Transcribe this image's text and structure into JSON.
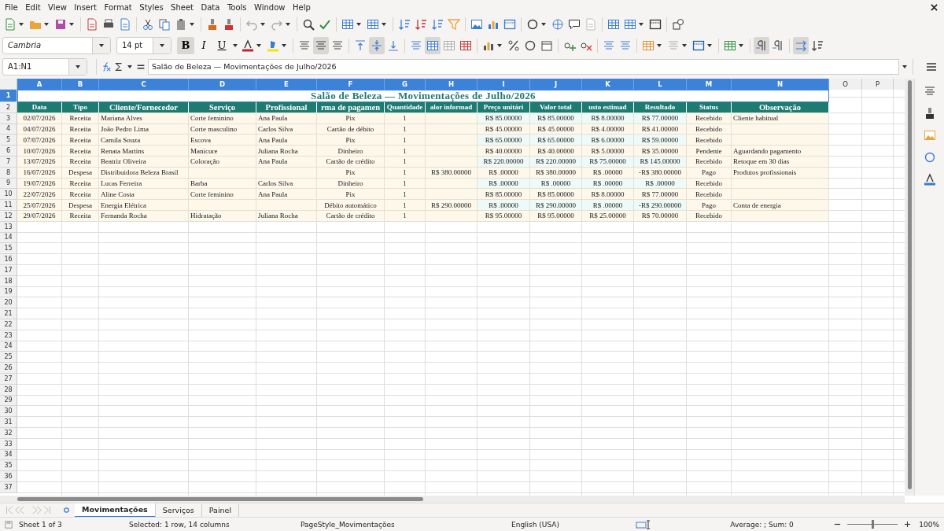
{
  "menu": [
    "File",
    "Edit",
    "View",
    "Insert",
    "Format",
    "Styles",
    "Sheet",
    "Data",
    "Tools",
    "Window",
    "Help"
  ],
  "font": {
    "name": "Cambria",
    "size": "14 pt"
  },
  "format_buttons": [
    {
      "label": "B",
      "pressed": true
    },
    {
      "label": "I",
      "pressed": false
    },
    {
      "label": "U",
      "pressed": false
    }
  ],
  "toggles": {
    "align_left": false,
    "align_center": true,
    "align_right": false,
    "align_top": false,
    "align_middle": true,
    "align_bottom": false,
    "wrap_text": false,
    "merge_center": true,
    "merge_cells": false,
    "unmerge_cells": false,
    "left_to_right": true,
    "right_to_left": false,
    "text_direction": true,
    "stacked_text": false
  },
  "formula_bar": {
    "name_box": "A1:N1",
    "content": "Salão de Beleza — Movimentações de Julho/2026"
  },
  "columns": [
    {
      "label": "A",
      "selected": true
    },
    {
      "label": "B",
      "selected": true
    },
    {
      "label": "C",
      "selected": true
    },
    {
      "label": "D",
      "selected": true
    },
    {
      "label": "E",
      "selected": true
    },
    {
      "label": "F",
      "selected": true
    },
    {
      "label": "G",
      "selected": true
    },
    {
      "label": "H",
      "selected": true
    },
    {
      "label": "I",
      "selected": true
    },
    {
      "label": "J",
      "selected": true
    },
    {
      "label": "K",
      "selected": true
    },
    {
      "label": "L",
      "selected": true
    },
    {
      "label": "M",
      "selected": true
    },
    {
      "label": "N",
      "selected": true
    },
    {
      "label": "O",
      "selected": false
    },
    {
      "label": "P",
      "selected": false
    }
  ],
  "rows": [
    {
      "label": "1",
      "selected": true
    },
    {
      "label": "2",
      "selected": false
    },
    {
      "label": "3",
      "selected": false
    },
    {
      "label": "4",
      "selected": false
    },
    {
      "label": "5",
      "selected": false
    },
    {
      "label": "6",
      "selected": false
    },
    {
      "label": "7",
      "selected": false
    },
    {
      "label": "8",
      "selected": false
    },
    {
      "label": "9",
      "selected": false
    },
    {
      "label": "10",
      "selected": false
    },
    {
      "label": "11",
      "selected": false
    },
    {
      "label": "12",
      "selected": false
    },
    {
      "label": "13",
      "selected": false
    },
    {
      "label": "14",
      "selected": false
    },
    {
      "label": "15",
      "selected": false
    },
    {
      "label": "16",
      "selected": false
    },
    {
      "label": "17",
      "selected": false
    },
    {
      "label": "18",
      "selected": false
    },
    {
      "label": "19",
      "selected": false
    },
    {
      "label": "20",
      "selected": false
    },
    {
      "label": "21",
      "selected": false
    },
    {
      "label": "22",
      "selected": false
    },
    {
      "label": "23",
      "selected": false
    },
    {
      "label": "24",
      "selected": false
    },
    {
      "label": "25",
      "selected": false
    },
    {
      "label": "26",
      "selected": false
    },
    {
      "label": "27",
      "selected": false
    },
    {
      "label": "28",
      "selected": false
    },
    {
      "label": "29",
      "selected": false
    },
    {
      "label": "30",
      "selected": false
    },
    {
      "label": "31",
      "selected": false
    },
    {
      "label": "32",
      "selected": false
    },
    {
      "label": "33",
      "selected": false
    },
    {
      "label": "34",
      "selected": false
    },
    {
      "label": "35",
      "selected": false
    },
    {
      "label": "36",
      "selected": false
    },
    {
      "label": "37",
      "selected": false
    }
  ],
  "sheet": {
    "title": "Salão de Beleza — Movimentações de Julho/2026",
    "headers": [
      "Data",
      "Tipo",
      "Cliente/Fornecedor",
      "Serviço",
      "Profissional",
      "rma de pagamen",
      "Quantidade",
      "alor informad",
      "Preço unitári",
      "Valor total",
      "usto estimad",
      "Resultado",
      "Status",
      "Observação"
    ],
    "records": [
      {
        "cells": [
          "02/07/2026",
          "Receita",
          "Mariana Alves",
          "Corte feminino",
          "Ana Paula",
          "Pix",
          "1",
          null,
          "R$ 85.00000",
          "R$ 85.00000",
          "R$ 8.00000",
          "R$ 77.00000",
          "Recebido",
          "Cliente habitual"
        ]
      },
      {
        "cells": [
          "04/07/2026",
          "Receita",
          "João Pedro Lima",
          "Corte masculino",
          "Carlos Silva",
          "Cartão de débito",
          "1",
          null,
          "R$ 45.00000",
          "R$ 45.00000",
          "R$ 4.00000",
          "R$ 41.00000",
          "Recebido",
          null
        ]
      },
      {
        "cells": [
          "07/07/2026",
          "Receita",
          "Camila Souza",
          "Escova",
          "Ana Paula",
          "Pix",
          "1",
          null,
          "R$ 65.00000",
          "R$ 65.00000",
          "R$ 6.00000",
          "R$ 59.00000",
          "Recebido",
          null
        ]
      },
      {
        "cells": [
          "10/07/2026",
          "Receita",
          "Renata Martins",
          "Manicure",
          "Juliana Rocha",
          "Dinheiro",
          "1",
          null,
          "R$ 40.00000",
          "R$ 40.00000",
          "R$ 5.00000",
          "R$ 35.00000",
          "Pendente",
          "Aguardando pagamento"
        ]
      },
      {
        "cells": [
          "13/07/2026",
          "Receita",
          "Beatriz Oliveira",
          "Coloração",
          "Ana Paula",
          "Cartão de crédito",
          "1",
          null,
          "R$ 220.00000",
          "R$ 220.00000",
          "R$ 75.00000",
          "R$ 145.00000",
          "Recebido",
          "Retoque em 30 dias"
        ]
      },
      {
        "cells": [
          "16/07/2026",
          "Despesa",
          "Distribuidora Beleza Brasil",
          null,
          null,
          "Pix",
          "1",
          "R$ 380.00000",
          "R$ .00000",
          "R$ 380.00000",
          "R$ .00000",
          "-R$ 380.00000",
          "Pago",
          "Produtos profissionais"
        ]
      },
      {
        "cells": [
          "19/07/2026",
          "Receita",
          "Lucas Ferreira",
          "Barba",
          "Carlos Silva",
          "Dinheiro",
          "1",
          null,
          "R$ .00000",
          "R$ .00000",
          "R$ .00000",
          "R$ .00000",
          "Recebido",
          null
        ]
      },
      {
        "cells": [
          "22/07/2026",
          "Receita",
          "Aline Costa",
          "Corte feminino",
          "Ana Paula",
          "Pix",
          "1",
          null,
          "R$ 85.00000",
          "R$ 85.00000",
          "R$ 8.00000",
          "R$ 77.00000",
          "Recebido",
          null
        ]
      },
      {
        "cells": [
          "25/07/2026",
          "Despesa",
          "Energia Elétrica",
          null,
          null,
          "Débito automático",
          "1",
          "R$ 290.00000",
          "R$ .00000",
          "R$ 290.00000",
          "R$ .00000",
          "-R$ 290.00000",
          "Pago",
          "Conta de energia"
        ]
      },
      {
        "cells": [
          "29/07/2026",
          "Receita",
          "Fernanda Rocha",
          "Hidratação",
          "Juliana Rocha",
          "Cartão de crédito",
          "1",
          null,
          "R$ 95.00000",
          "R$ 95.00000",
          "R$ 25.00000",
          "R$ 70.00000",
          "Recebido",
          null
        ]
      }
    ]
  },
  "sheet_tabs": [
    {
      "label": "Movimentações",
      "selected": true
    },
    {
      "label": "Serviços",
      "selected": false
    },
    {
      "label": "Painel",
      "selected": false
    }
  ],
  "status_bar": {
    "sheet": "Sheet 1 of 3",
    "selection": "Selected: 1 row, 14 columns",
    "page_style": "PageStyle_Movimentações",
    "language": "English (USA)",
    "summary": "Average: ; Sum: 0",
    "zoom": "100%",
    "zoom_slider": {
      "level": 0.5
    }
  }
}
